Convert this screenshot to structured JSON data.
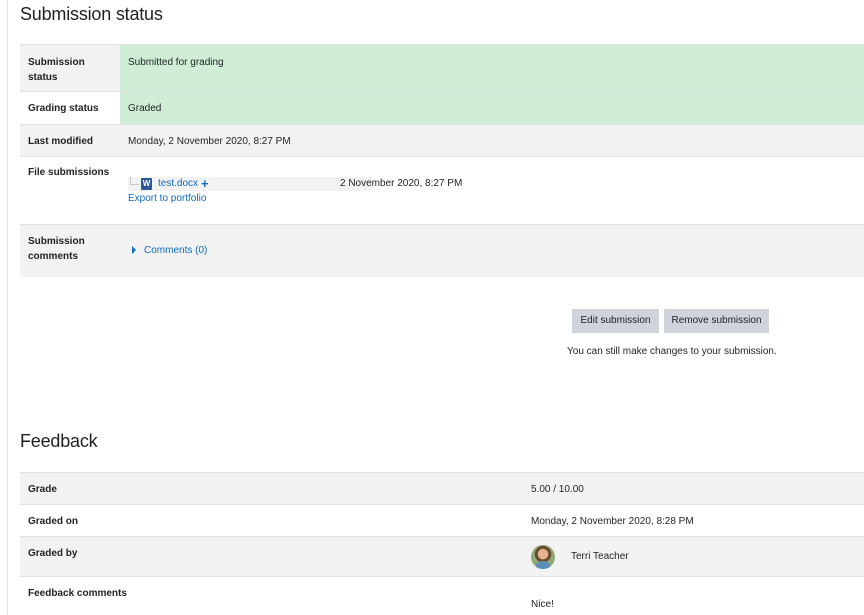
{
  "submission_status": {
    "title": "Submission status",
    "rows": {
      "submission_status": {
        "label": "Submission status",
        "value": "Submitted for grading"
      },
      "grading_status": {
        "label": "Grading status",
        "value": "Graded"
      },
      "last_modified": {
        "label": "Last modified",
        "value": "Monday, 2 November 2020, 8:27 PM"
      },
      "file_submissions": {
        "label": "File submissions",
        "file_name": "test.docx",
        "file_icon": "word-document-icon",
        "file_date": "2 November 2020, 8:27 PM",
        "export_link": "Export to portfolio"
      },
      "submission_comments": {
        "label": "Submission comments",
        "comments_link": "Comments (0)"
      }
    },
    "actions": {
      "edit_label": "Edit submission",
      "remove_label": "Remove submission",
      "hint": "You can still make changes to your submission."
    }
  },
  "feedback": {
    "title": "Feedback",
    "rows": {
      "grade": {
        "label": "Grade",
        "value": "5.00 / 10.00"
      },
      "graded_on": {
        "label": "Graded on",
        "value": "Monday, 2 November 2020, 8:28 PM"
      },
      "graded_by": {
        "label": "Graded by",
        "value": "Terri Teacher"
      },
      "feedback_comments": {
        "label": "Feedback comments",
        "value": "Nice!"
      }
    }
  },
  "colors": {
    "status_success_bg": "#cfeed5",
    "row_stripe": "#f2f2f2",
    "link": "#0f6cbf",
    "button_bg": "#ced4da"
  }
}
